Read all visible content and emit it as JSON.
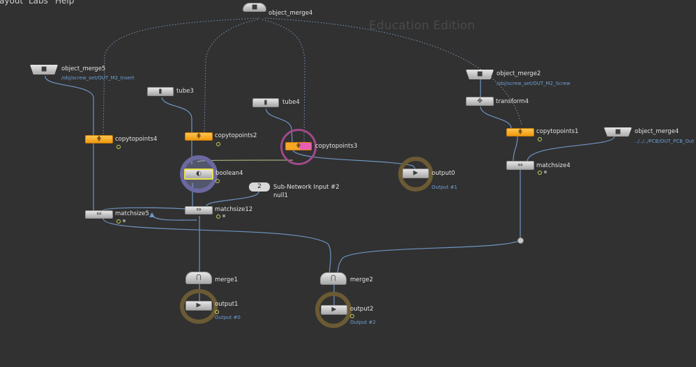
{
  "menu": {
    "items": [
      "ayout",
      "Labs",
      "Help"
    ]
  },
  "watermark": "Education Edition",
  "nodes": {
    "object_merge4_top": {
      "name": "object_merge4"
    },
    "object_merge5": {
      "name": "object_merge5",
      "path": "/obj/screw_set/OUT_M2_Insert"
    },
    "tube3": {
      "name": "tube3"
    },
    "tube4": {
      "name": "tube4"
    },
    "object_merge2": {
      "name": "object_merge2",
      "path": "/obj/screw_set/OUT_M2_Screw"
    },
    "transform4": {
      "name": "transform4"
    },
    "copytopoints4": {
      "name": "copytopoints4"
    },
    "copytopoints2": {
      "name": "copytopoints2"
    },
    "copytopoints3": {
      "name": "copytopoints3"
    },
    "copytopoints1": {
      "name": "copytopoints1"
    },
    "object_merge4_right": {
      "name": "object_merge4",
      "path": "../../../PCB/OUT_PCB_Out"
    },
    "boolean4": {
      "name": "boolean4"
    },
    "output0": {
      "name": "output0",
      "sub": "Output #1"
    },
    "matchsize4": {
      "name": "matchsize4"
    },
    "subnet_input": {
      "badge": "2",
      "name": "Sub-Network Input #2",
      "null_name": "null1"
    },
    "matchsize5": {
      "name": "matchsize5"
    },
    "matchsize12": {
      "name": "matchsize12"
    },
    "merge1": {
      "name": "merge1"
    },
    "output1": {
      "name": "output1",
      "sub": "Output #0"
    },
    "merge2": {
      "name": "merge2"
    },
    "output2": {
      "name": "output2",
      "sub": "Output #2"
    }
  },
  "colors": {
    "background": "#313131",
    "wire": "#6f95c4",
    "wire_reference": "#7a96b8",
    "copy_node": "#f5a623",
    "sop_node": "#d0d0d0",
    "selected_wire": "#b9c88a",
    "display_ring": "#6b69a0",
    "output_ring": "#6b5a34",
    "highlight_ring": "#a04a8a"
  },
  "icons": {
    "object_merge": "object-merge-icon",
    "tube": "tube-icon",
    "copytopoints": "copy-to-points-icon",
    "transform": "transform-icon",
    "boolean": "boolean-icon",
    "matchsize": "match-size-icon",
    "merge": "merge-icon",
    "output": "output-icon"
  }
}
